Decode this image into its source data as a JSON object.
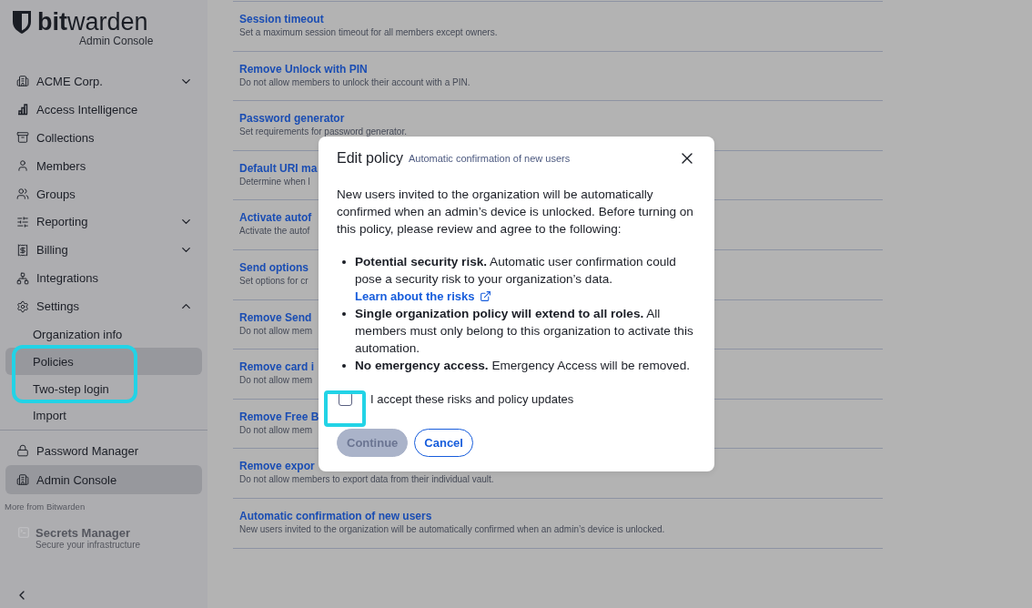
{
  "sidebar": {
    "logo": {
      "wordmark": "**bit**warden",
      "subtitle": "Admin Console"
    },
    "nav": [
      {
        "label": "ACME Corp.",
        "expanded": false
      },
      {
        "label": "Access Intelligence"
      },
      {
        "label": "Collections"
      },
      {
        "label": "Members"
      },
      {
        "label": "Groups"
      },
      {
        "label": "Reporting",
        "expanded": false
      },
      {
        "label": "Billing",
        "expanded": false
      },
      {
        "label": "Integrations"
      },
      {
        "label": "Settings",
        "expanded": true,
        "children": [
          {
            "label": "Organization info",
            "selected": false
          },
          {
            "label": "Policies",
            "selected": true
          },
          {
            "label": "Two-step login",
            "selected": false
          },
          {
            "label": "Import",
            "selected": false
          }
        ]
      }
    ],
    "products": [
      {
        "label": "Password Manager",
        "selected": false
      },
      {
        "label": "Admin Console",
        "selected": true
      }
    ],
    "more": {
      "heading": "More from Bitwarden",
      "items": [
        {
          "label": "Secrets Manager",
          "description": "Secure your infrastructure"
        }
      ]
    }
  },
  "policies": [
    {
      "title": "Session timeout",
      "description": "Set a maximum session timeout for all members except owners."
    },
    {
      "title": "Remove Unlock with PIN",
      "description": "Do not allow members to unlock their account with a PIN."
    },
    {
      "title": "Password generator",
      "description": "Set requirements for password generator."
    },
    {
      "title": "Default URI ma",
      "description": "Determine when l"
    },
    {
      "title": "Activate autof",
      "description": "Activate the autof"
    },
    {
      "title": "Send options",
      "description": "Set options for cr"
    },
    {
      "title": "Remove Send",
      "description": "Do not allow mem"
    },
    {
      "title": "Remove card i",
      "description": "Do not allow mem"
    },
    {
      "title": "Remove Free B",
      "description": "Do not allow mem"
    },
    {
      "title": "Remove expor",
      "description": "Do not allow members to export data from their individual vault."
    },
    {
      "title": "Automatic confirmation of new users",
      "description": "New users invited to the organization will be automatically confirmed when an admin’s device is unlocked."
    }
  ],
  "dialog": {
    "title": "Edit policy",
    "subtitle": "Automatic confirmation of new users",
    "intro": "New users invited to the organization will be automatically confirmed when an admin’s device is unlocked. Before turning on this policy, please review and agree to the following:",
    "bullets": [
      {
        "text": "**Potential security risk.** Automatic user confirmation could pose a security risk to your organization’s data.",
        "link": "Learn about the risks"
      },
      {
        "text": "**Single organization policy will extend to all roles.** All members must only belong to this organization to activate this automation."
      },
      {
        "text": "**No emergency access.** Emergency Access will be removed."
      }
    ],
    "checkbox": {
      "label": "I accept these risks and policy updates",
      "checked": false
    },
    "buttons": [
      {
        "label": "Continue",
        "kind": "primary",
        "disabled": true
      },
      {
        "label": "Cancel",
        "kind": "secondary",
        "disabled": false
      }
    ]
  }
}
